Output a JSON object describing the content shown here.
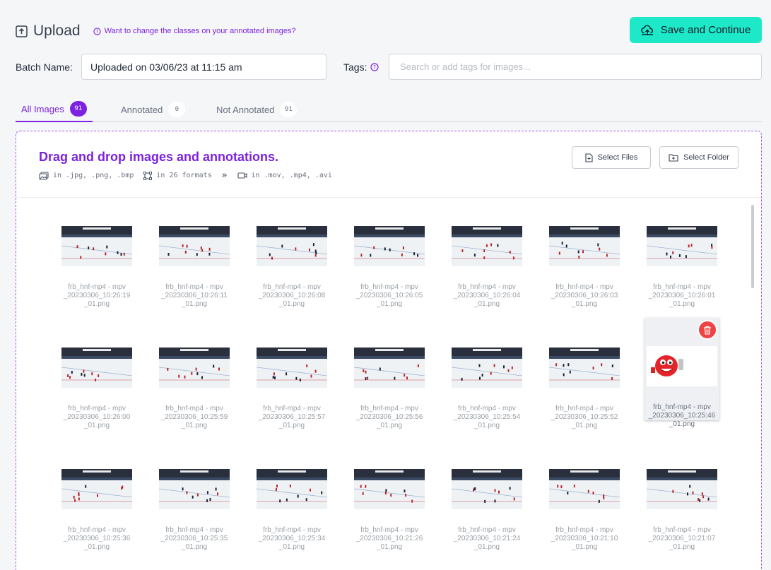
{
  "header": {
    "title": "Upload",
    "help_link": "Want to change the classes on your annotated images?",
    "save_button": "Save and Continue"
  },
  "batch": {
    "label": "Batch Name:",
    "value": "Uploaded on 03/06/23 at 11:15 am"
  },
  "tags": {
    "label": "Tags:",
    "placeholder": "Search or add tags for images..."
  },
  "tabs": [
    {
      "label": "All Images",
      "count": "91",
      "active": true
    },
    {
      "label": "Annotated",
      "count": "0",
      "active": false
    },
    {
      "label": "Not Annotated",
      "count": "91",
      "active": false
    }
  ],
  "dropzone": {
    "title": "Drag and drop images and annotations.",
    "formats": {
      "images": "in .jpg, .png, .bmp",
      "annotations": "in 26 formats",
      "arrow": "»",
      "videos": "in .mov, .mp4, .avi"
    },
    "select_files": "Select Files",
    "select_folder": "Select Folder"
  },
  "images": [
    {
      "line1": "frb_hnf-mp4 - mpv",
      "line2": "_20230306_10:26:19",
      "line3": "_01.png",
      "kind": "hockey"
    },
    {
      "line1": "frb_hnf-mp4 - mpv",
      "line2": "_20230306_10:26:11",
      "line3": "_01.png",
      "kind": "hockey"
    },
    {
      "line1": "frb_hnf-mp4 - mpv",
      "line2": "_20230306_10:26:08",
      "line3": "_01.png",
      "kind": "hockey"
    },
    {
      "line1": "frb_hnf-mp4 - mpv",
      "line2": "_20230306_10:26:05",
      "line3": "_01.png",
      "kind": "hockey"
    },
    {
      "line1": "frb_hnf-mp4 - mpv",
      "line2": "_20230306_10:26:04",
      "line3": "_01.png",
      "kind": "hockey"
    },
    {
      "line1": "frb_hnf-mp4 - mpv",
      "line2": "_20230306_10:26:03",
      "line3": "_01.png",
      "kind": "hockey"
    },
    {
      "line1": "frb_hnf-mp4 - mpv",
      "line2": "_20230306_10:26:01",
      "line3": "_01.png",
      "kind": "hockey"
    },
    {
      "line1": "frb_hnf-mp4 - mpv",
      "line2": "_20230306_10:26:00",
      "line3": "_01.png",
      "kind": "hockey"
    },
    {
      "line1": "frb_hnf-mp4 - mpv",
      "line2": "_20230306_10:25:59",
      "line3": "_01.png",
      "kind": "hockey"
    },
    {
      "line1": "frb_hnf-mp4 - mpv",
      "line2": "_20230306_10:25:57",
      "line3": "_01.png",
      "kind": "hockey"
    },
    {
      "line1": "frb_hnf-mp4 - mpv",
      "line2": "_20230306_10:25:56",
      "line3": "_01.png",
      "kind": "hockey"
    },
    {
      "line1": "frb_hnf-mp4 - mpv",
      "line2": "_20230306_10:25:54",
      "line3": "_01.png",
      "kind": "hockey"
    },
    {
      "line1": "frb_hnf-mp4 - mpv",
      "line2": "_20230306_10:25:52",
      "line3": "_01.png",
      "kind": "hockey"
    },
    {
      "line1": "frb_hnf-mp4 - mpv",
      "line2": "_20230306_10:25:46",
      "line3": "_01.png",
      "kind": "mascot",
      "selected": true
    },
    {
      "line1": "frb_hnf-mp4 - mpv",
      "line2": "_20230306_10:25:36",
      "line3": "_01.png",
      "kind": "hockey"
    },
    {
      "line1": "frb_hnf-mp4 - mpv",
      "line2": "_20230306_10:25:35",
      "line3": "_01.png",
      "kind": "hockey"
    },
    {
      "line1": "frb_hnf-mp4 - mpv",
      "line2": "_20230306_10:25:34",
      "line3": "_01.png",
      "kind": "hockey"
    },
    {
      "line1": "frb_hnf-mp4 - mpv",
      "line2": "_20230306_10:21:26",
      "line3": "_01.png",
      "kind": "hockey"
    },
    {
      "line1": "frb_hnf-mp4 - mpv",
      "line2": "_20230306_10:21:24",
      "line3": "_01.png",
      "kind": "hockey"
    },
    {
      "line1": "frb_hnf-mp4 - mpv",
      "line2": "_20230306_10:21:10",
      "line3": "_01.png",
      "kind": "hockey"
    },
    {
      "line1": "frb_hnf-mp4 - mpv",
      "line2": "_20230306_10:21:07",
      "line3": "_01.png",
      "kind": "hockey"
    }
  ],
  "colors": {
    "accent": "#7c22e0",
    "save_bg": "#1de9c9",
    "trash": "#ef4444"
  },
  "icons": {
    "upload": "upload-box-icon",
    "help": "question-circle-icon",
    "save": "cloud-upload-icon",
    "images": "images-icon",
    "annotations": "bounding-box-icon",
    "video": "video-icon",
    "file": "file-plus-icon",
    "folder": "folder-plus-icon",
    "delete": "trash-icon"
  }
}
